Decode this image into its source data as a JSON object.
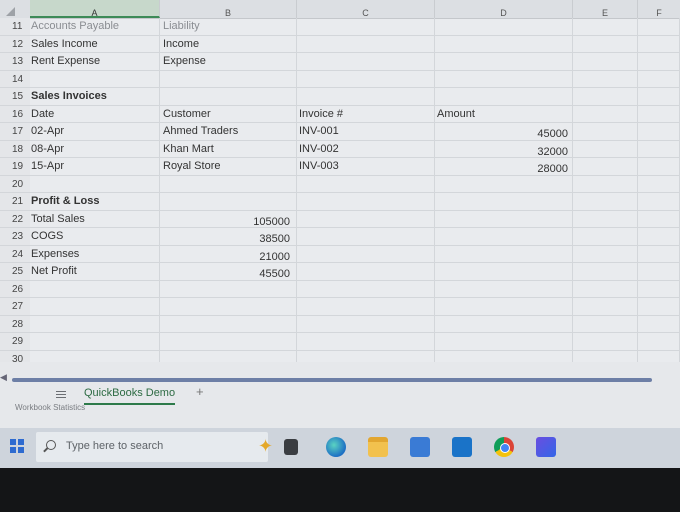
{
  "columns": [
    "A",
    "B",
    "C",
    "D",
    "E",
    "F"
  ],
  "rows": [
    {
      "n": "11",
      "a": "Accounts Payable",
      "b": "Liability",
      "c": "",
      "d": "",
      "style": "faded"
    },
    {
      "n": "12",
      "a": "Sales Income",
      "b": "Income",
      "c": "",
      "d": ""
    },
    {
      "n": "13",
      "a": "Rent Expense",
      "b": "Expense",
      "c": "",
      "d": ""
    },
    {
      "n": "14",
      "a": "",
      "b": "",
      "c": "",
      "d": ""
    },
    {
      "n": "15",
      "a": "Sales Invoices",
      "b": "",
      "c": "",
      "d": "",
      "bold": true
    },
    {
      "n": "16",
      "a": "Date",
      "b": "Customer",
      "c": "Invoice #",
      "d": "Amount"
    },
    {
      "n": "17",
      "a": "02-Apr",
      "b": "Ahmed Traders",
      "c": "INV-001",
      "d": "45000"
    },
    {
      "n": "18",
      "a": "08-Apr",
      "b": "Khan Mart",
      "c": "INV-002",
      "d": "32000"
    },
    {
      "n": "19",
      "a": "15-Apr",
      "b": "Royal Store",
      "c": "INV-003",
      "d": "28000"
    },
    {
      "n": "20",
      "a": "",
      "b": "",
      "c": "",
      "d": ""
    },
    {
      "n": "21",
      "a": "Profit & Loss",
      "b": "",
      "c": "",
      "d": "",
      "bold": true
    },
    {
      "n": "22",
      "a": "Total Sales",
      "b": "105000",
      "c": "",
      "d": ""
    },
    {
      "n": "23",
      "a": "COGS",
      "b": "38500",
      "c": "",
      "d": ""
    },
    {
      "n": "24",
      "a": "Expenses",
      "b": "21000",
      "c": "",
      "d": ""
    },
    {
      "n": "25",
      "a": "Net Profit",
      "b": "45500",
      "c": "",
      "d": ""
    },
    {
      "n": "26",
      "a": "",
      "b": "",
      "c": "",
      "d": ""
    },
    {
      "n": "27",
      "a": "",
      "b": "",
      "c": "",
      "d": ""
    },
    {
      "n": "28",
      "a": "",
      "b": "",
      "c": "",
      "d": ""
    },
    {
      "n": "29",
      "a": "",
      "b": "",
      "c": "",
      "d": ""
    },
    {
      "n": "30",
      "a": "",
      "b": "",
      "c": "",
      "d": ""
    }
  ],
  "sheet": {
    "tab_label": "QuickBooks Demo",
    "add_label": "+",
    "status": "Workbook Statistics"
  },
  "taskbar": {
    "search_placeholder": "Type here to search",
    "icons": [
      "task-view-icon",
      "edge-icon",
      "file-explorer-icon",
      "store-icon",
      "outlook-icon",
      "chrome-icon",
      "news-icon"
    ]
  },
  "colors": {
    "selected_column": "#c7d8cb",
    "sheet_tab_accent": "#2d7a4a",
    "scrollbar": "#6d7fa6"
  }
}
